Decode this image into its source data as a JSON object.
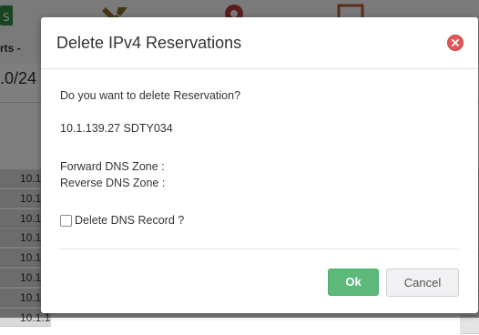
{
  "background": {
    "tab_label": "rts -",
    "subnet_fragment": ".0/24",
    "row_fragments": [
      "10.1",
      "10.1.",
      "10.1.",
      "10.1.1",
      "10.1.1",
      "10.1.1",
      "10.1.1",
      "10.1.1"
    ],
    "right_mark": "≡"
  },
  "dialog": {
    "title": "Delete IPv4 Reservations",
    "close_icon": "close-circle-icon",
    "question": "Do you want to delete Reservation?",
    "reservation": "10.1.139.27 SDTY034",
    "forward_zone_label": "Forward DNS Zone :",
    "reverse_zone_label": "Reverse DNS Zone :",
    "delete_dns_label": "Delete DNS Record ?",
    "delete_dns_checked": false,
    "ok_label": "Ok",
    "cancel_label": "Cancel"
  },
  "colors": {
    "ok_button": "#5cb97a",
    "close_button": "#e05a5a",
    "overlay": "rgba(0,0,0,0.5)"
  }
}
